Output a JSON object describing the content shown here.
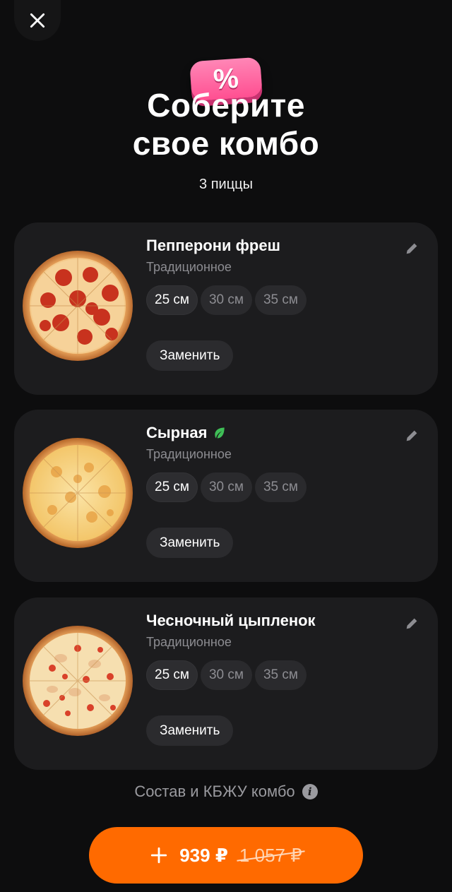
{
  "header": {
    "badge": "%",
    "title_line1": "Соберите",
    "title_line2": "свое комбо",
    "subtitle": "3 пиццы"
  },
  "pizzas": [
    {
      "name": "Пепперони фреш",
      "dough": "Традиционное",
      "sizes": [
        "25 см",
        "30 см",
        "35 см"
      ],
      "selected_size": "25 см",
      "replace_label": "Заменить",
      "vegetarian": false
    },
    {
      "name": "Сырная",
      "dough": "Традиционное",
      "sizes": [
        "25 см",
        "30 см",
        "35 см"
      ],
      "selected_size": "25 см",
      "replace_label": "Заменить",
      "vegetarian": true
    },
    {
      "name": "Чесночный цыпленок",
      "dough": "Традиционное",
      "sizes": [
        "25 см",
        "30 см",
        "35 см"
      ],
      "selected_size": "25 см",
      "replace_label": "Заменить",
      "vegetarian": false
    }
  ],
  "composition_link": "Состав и КБЖУ комбо",
  "cta": {
    "price": "939 ₽",
    "old_price": "1 057 ₽"
  },
  "icons": {
    "close": "close-icon",
    "edit": "pencil-icon",
    "vegetarian": "leaf-icon",
    "info": "info-icon",
    "plus": "plus-icon"
  },
  "colors": {
    "background": "#0d0d0e",
    "card": "#1c1c1e",
    "accent": "#ff6a00",
    "badge": "#ff5c9a",
    "leaf": "#3fbf57"
  }
}
